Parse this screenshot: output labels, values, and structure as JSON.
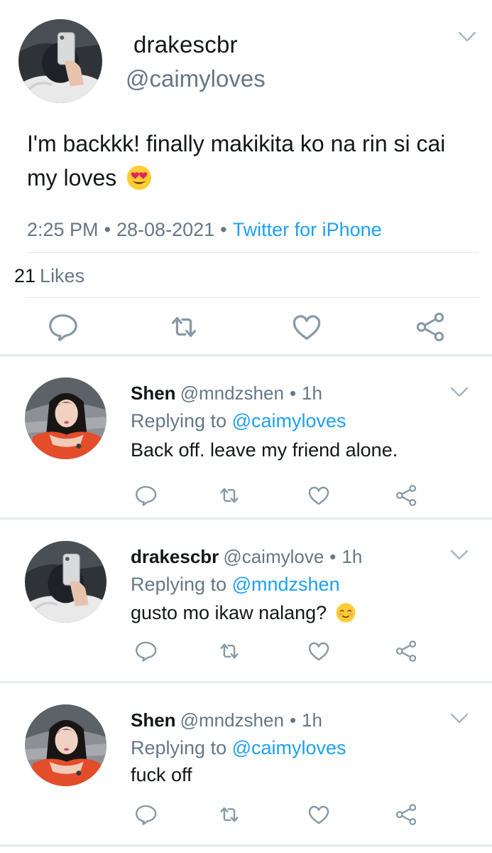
{
  "main_tweet": {
    "display_name": "drakescbr",
    "handle": "@caimyloves",
    "text": "I'm backkk! finally makikita ko na rin si cai my loves",
    "emoji": "heart-eyes-emoji",
    "time": "2:25 PM",
    "date": "28-08-2021",
    "source": "Twitter for iPhone",
    "likes_count": "21",
    "likes_label": "Likes"
  },
  "replies": [
    {
      "name": "Shen",
      "handle": "@mndzshen",
      "time": "1h",
      "replying_prefix": "Replying to",
      "replying_to": "@caimyloves",
      "text": "Back off. leave my friend alone.",
      "avatar": "girl-avatar"
    },
    {
      "name": "drakescbr",
      "handle": "@caimylove",
      "time": "1h",
      "replying_prefix": "Replying to",
      "replying_to": "@mndzshen",
      "text": "gusto mo ikaw nalang?",
      "emoji": "smiling-blush-emoji",
      "avatar": "mirror-selfie-avatar"
    },
    {
      "name": "Shen",
      "handle": "@mndzshen",
      "time": "1h",
      "replying_prefix": "Replying to",
      "replying_to": "@caimyloves",
      "text": "fuck off",
      "avatar": "girl-avatar"
    }
  ],
  "separator": "•",
  "icons": [
    "chevron-down-icon",
    "reply-icon",
    "retweet-icon",
    "like-icon",
    "share-icon"
  ],
  "colors": {
    "link": "#1da1f2",
    "muted": "#657786",
    "icon": "#8899a6",
    "divider": "#e6ecf0"
  }
}
